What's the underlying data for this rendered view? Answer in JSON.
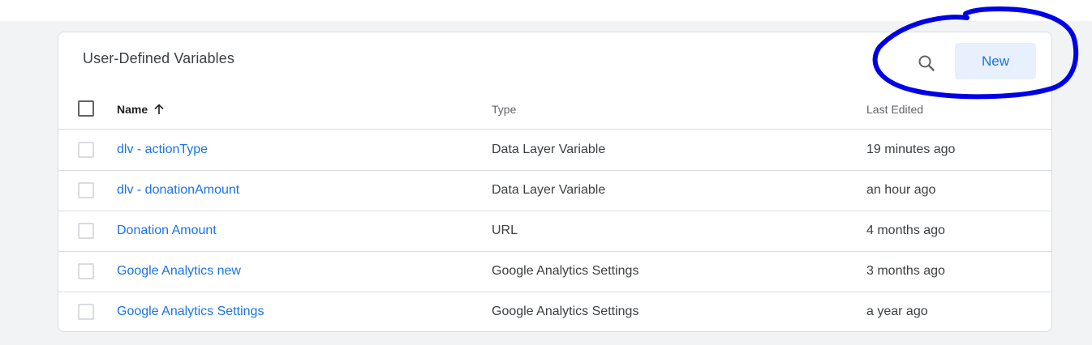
{
  "card": {
    "title": "User-Defined Variables",
    "new_label": "New",
    "search_icon": "search-icon"
  },
  "table": {
    "columns": {
      "name": "Name",
      "type": "Type",
      "last_edited": "Last Edited"
    },
    "sort_icon": "arrow-up-icon",
    "rows": [
      {
        "name": "dlv - actionType",
        "type": "Data Layer Variable",
        "last_edited": "19 minutes ago"
      },
      {
        "name": "dlv - donationAmount",
        "type": "Data Layer Variable",
        "last_edited": "an hour ago"
      },
      {
        "name": "Donation Amount",
        "type": "URL",
        "last_edited": "4 months ago"
      },
      {
        "name": "Google Analytics new",
        "type": "Google Analytics Settings",
        "last_edited": "3 months ago"
      },
      {
        "name": "Google Analytics Settings",
        "type": "Google Analytics Settings",
        "last_edited": "a year ago"
      }
    ]
  },
  "colors": {
    "accent": "#1a73e8",
    "button_bg": "#e8f0fe",
    "annotation": "#0000e6"
  }
}
